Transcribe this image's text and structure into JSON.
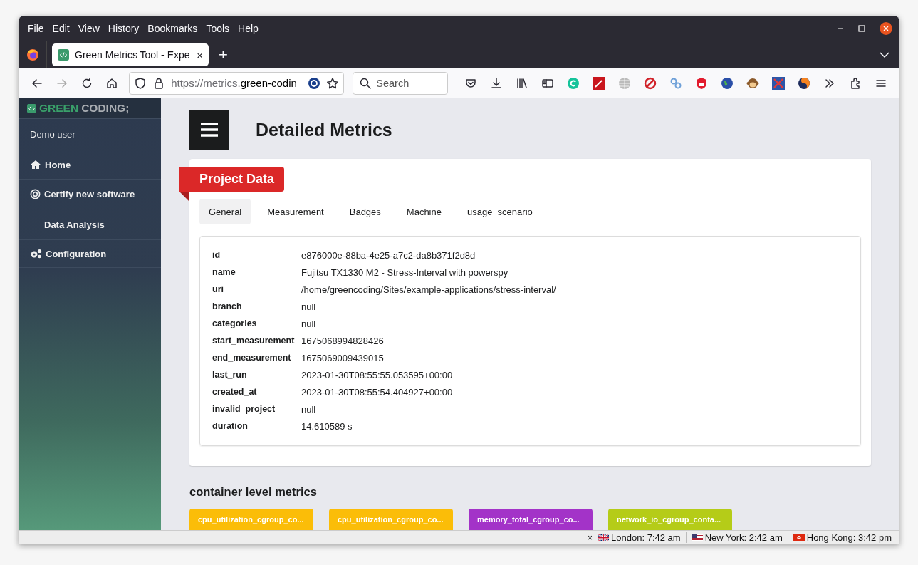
{
  "menu_bar": [
    "File",
    "Edit",
    "View",
    "History",
    "Bookmarks",
    "Tools",
    "Help"
  ],
  "tabs": [
    {
      "title": "Green Metrics Tool - Expe",
      "close": "×",
      "selected": true
    }
  ],
  "new_tab": "+",
  "address_bar": {
    "scheme_and_sub": "https://metrics.",
    "host": "green-codin"
  },
  "search": {
    "placeholder": "Search"
  },
  "sidebar": {
    "logo_green": "GREEN",
    "logo_grey": "CODING;",
    "user": "Demo user",
    "items": [
      {
        "label": "Home",
        "indented": false
      },
      {
        "label": "Certify new software",
        "indented": false
      },
      {
        "label": "Data Analysis",
        "indented": true
      },
      {
        "label": "Configuration",
        "indented": false
      }
    ]
  },
  "page_title": "Detailed Metrics",
  "project_card": {
    "ribbon": "Project Data",
    "tabs": [
      {
        "label": "General",
        "selected": true
      },
      {
        "label": "Measurement",
        "selected": false
      },
      {
        "label": "Badges",
        "selected": false
      },
      {
        "label": "Machine",
        "selected": false
      },
      {
        "label": "usage_scenario",
        "selected": false
      }
    ],
    "rows": [
      {
        "key": "id",
        "value": "e876000e-88ba-4e25-a7c2-da8b371f2d8d"
      },
      {
        "key": "name",
        "value": "Fujitsu TX1330 M2 - Stress-Interval with powerspy"
      },
      {
        "key": "uri",
        "value": "/home/greencoding/Sites/example-applications/stress-interval/"
      },
      {
        "key": "branch",
        "value": "null"
      },
      {
        "key": "categories",
        "value": "null"
      },
      {
        "key": "start_measurement",
        "value": "1675068994828426"
      },
      {
        "key": "end_measurement",
        "value": "1675069009439015"
      },
      {
        "key": "last_run",
        "value": "2023-01-30T08:55:55.053595+00:00"
      },
      {
        "key": "created_at",
        "value": "2023-01-30T08:55:54.404927+00:00"
      },
      {
        "key": "invalid_project",
        "value": "null"
      },
      {
        "key": "duration",
        "value": "14.610589 s"
      }
    ]
  },
  "container_section": {
    "heading": "container level metrics",
    "metrics": [
      {
        "label": "cpu_utilization_cgroup_co...",
        "color": "#fbbd08"
      },
      {
        "label": "cpu_utilization_cgroup_co...",
        "color": "#fbbd08"
      },
      {
        "label": "memory_total_cgroup_co...",
        "color": "#a333c8"
      },
      {
        "label": "network_io_cgroup_conta...",
        "color": "#b5cc18"
      }
    ]
  },
  "status_bar": {
    "close": "×",
    "clocks": [
      {
        "text": "London: 7:42 am"
      },
      {
        "text": "New York: 2:42 am"
      },
      {
        "text": "Hong Kong: 3:42 pm"
      }
    ]
  }
}
